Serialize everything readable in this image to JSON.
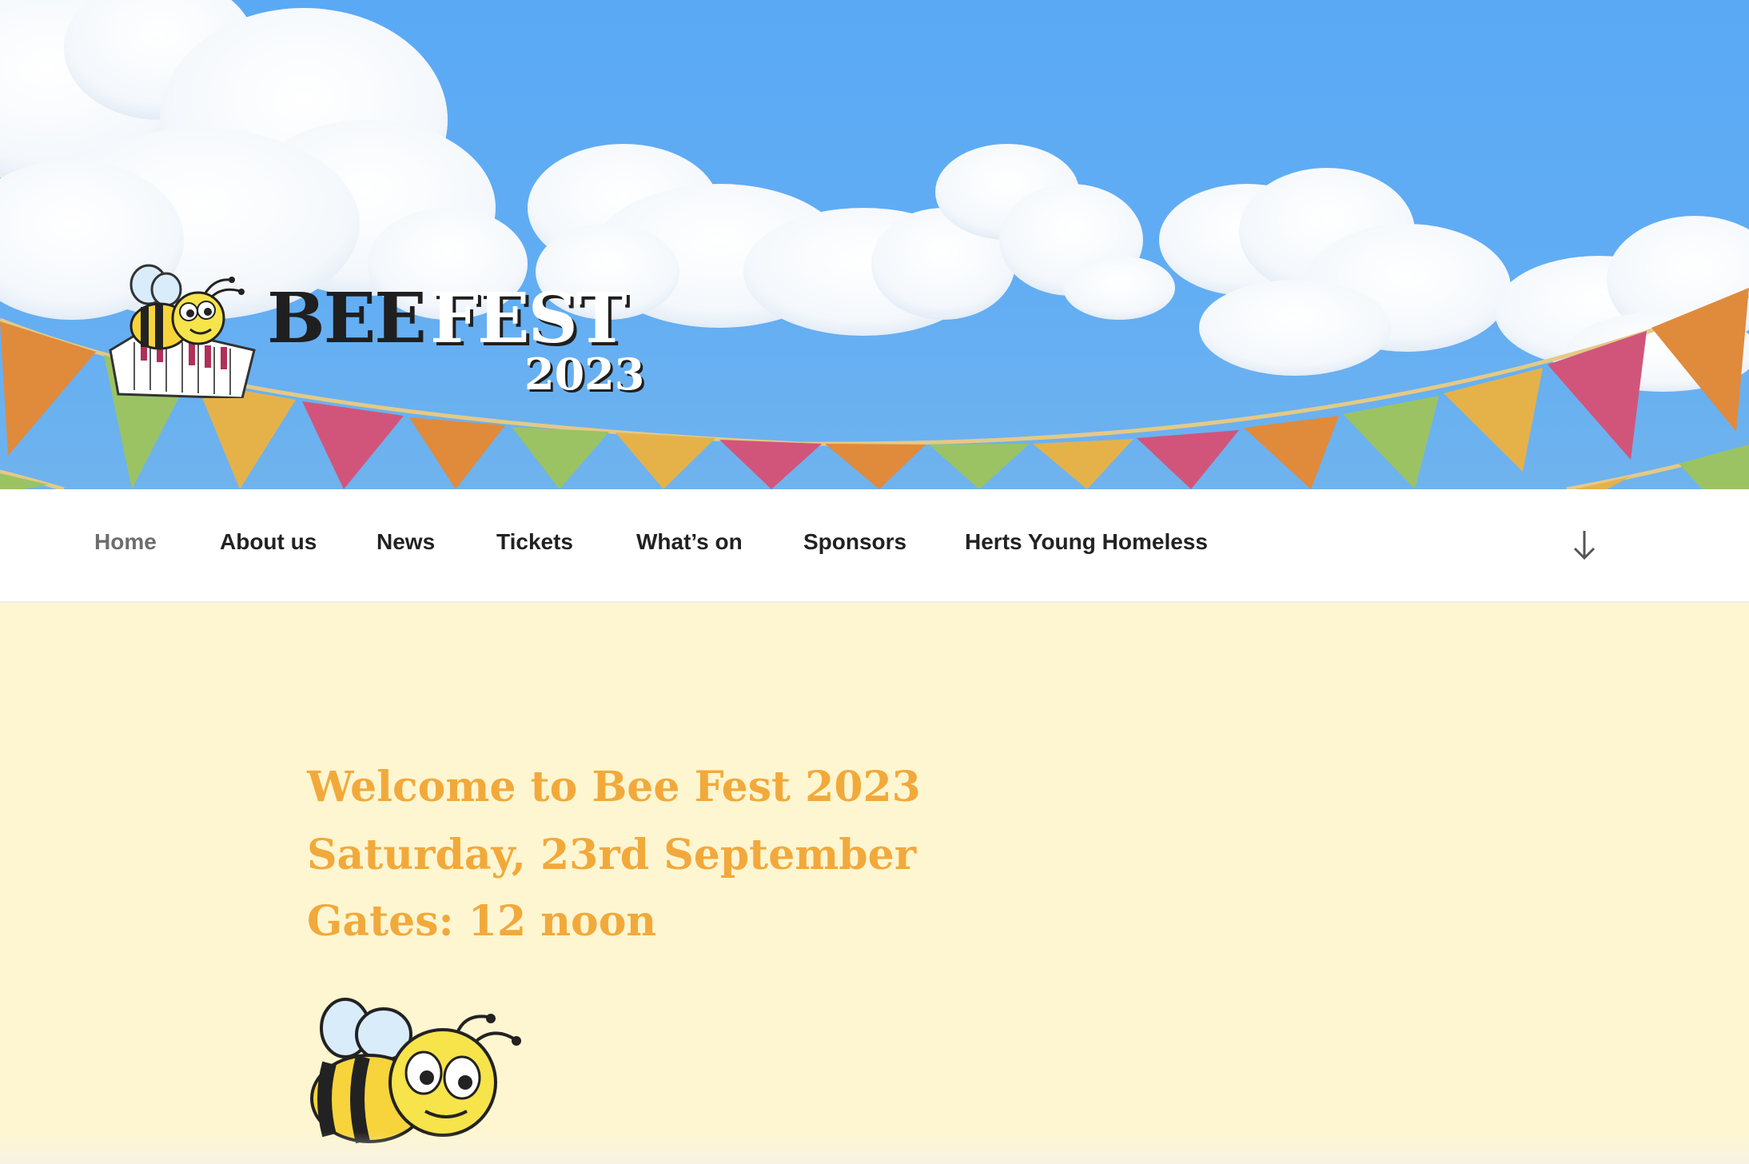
{
  "header": {
    "logo": {
      "word1": "BEE",
      "word2": "FEST",
      "year": "2023"
    }
  },
  "nav": {
    "items": [
      {
        "label": "Home",
        "active": true
      },
      {
        "label": "About us"
      },
      {
        "label": "News"
      },
      {
        "label": "Tickets"
      },
      {
        "label": "What’s on"
      },
      {
        "label": "Sponsors"
      },
      {
        "label": "Herts Young Homeless"
      }
    ],
    "scroll_icon": "arrow-down-icon"
  },
  "main": {
    "lines": [
      "Welcome to Bee Fest 2023",
      "Saturday, 23rd September",
      "Gates: 12 noon"
    ]
  },
  "colors": {
    "sky": "#5aa9f5",
    "heading": "#f2a93b",
    "page_background": "#fef6d1",
    "nav_text": "#222222",
    "nav_active": "#6d6d6d"
  }
}
